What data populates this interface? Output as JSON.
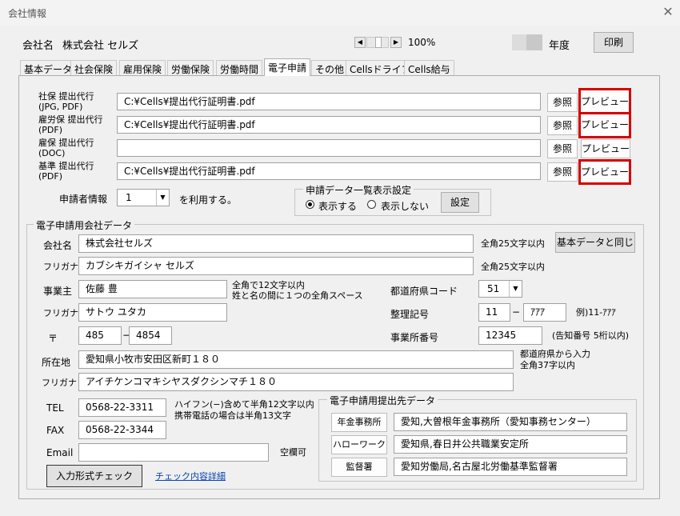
{
  "window": {
    "title": "会社情報",
    "close_glyph": "✕"
  },
  "header": {
    "company_label": "会社名",
    "company_name": "株式会社 セルズ",
    "zoom": "100%",
    "year_label": "年度",
    "print_label": "印刷"
  },
  "tabs": [
    "基本データ",
    "社会保険",
    "雇用保険",
    "労働保険",
    "労働時間",
    "電子申請",
    "その他",
    "Cellsドライブ",
    "Cells給与"
  ],
  "active_tab": "電子申請",
  "agency": {
    "rows": [
      {
        "label1": "社保 提出代行",
        "label2": "(JPG, PDF)",
        "path": "C:¥Cells¥提出代行証明書.pdf",
        "browse": "参照",
        "preview": "プレビュー",
        "highlight": true
      },
      {
        "label1": "雇労保 提出代行",
        "label2": "(PDF)",
        "path": "C:¥Cells¥提出代行証明書.pdf",
        "browse": "参照",
        "preview": "プレビュー",
        "highlight": true
      },
      {
        "label1": "雇保 提出代行",
        "label2": "(DOC)",
        "path": "",
        "browse": "参照",
        "preview": "プレビュー",
        "highlight": false
      },
      {
        "label1": "基準 提出代行",
        "label2": "(PDF)",
        "path": "C:¥Cells¥提出代行証明書.pdf",
        "browse": "参照",
        "preview": "プレビュー",
        "highlight": true
      }
    ]
  },
  "applicant": {
    "label": "申請者情報",
    "value": "1",
    "suffix": "を利用する。"
  },
  "list_display": {
    "title": "申請データ一覧表示設定",
    "option_show": "表示する",
    "option_hide": "表示しない",
    "selected": "表示する",
    "settings_label": "設定"
  },
  "company_data": {
    "group_title": "電子申請用会社データ",
    "company_name_label": "会社名",
    "company_name": "株式会社セルズ",
    "company_name_note": "全角25文字以内",
    "same_as_basic": "基本データと同じ",
    "furigana_label": "フリガナ",
    "furigana": "カブシキガイシャ セルズ",
    "furigana_note": "全角25文字以内",
    "owner_label": "事業主",
    "owner": "佐藤 豊",
    "owner_note1": "全角で12文字以内",
    "owner_note2": "姓と名の間に１つの全角スペース",
    "owner_kana_label": "フリガナ",
    "owner_kana": "サトウ ユタカ",
    "postal_label": "〒",
    "postal1": "485",
    "postal_dash": "−",
    "postal2": "4854",
    "pref_code_label": "都道府県コード",
    "pref_code": "51",
    "ref_no_label": "整理記号",
    "ref_no1": "11",
    "ref_no_dash": "−",
    "ref_no2": "ｱｱｱ",
    "ref_no_example": "例)11-ｱｱｱ",
    "office_no_label": "事業所番号",
    "office_no": "12345",
    "office_no_note": "(告知番号 5桁以内)",
    "address_label": "所在地",
    "address": "愛知県小牧市安田区新町１８０",
    "address_note1": "都道府県から入力",
    "address_note2": "全角37字以内",
    "address_kana_label": "フリガナ",
    "address_kana": "アイチケンコマキシヤスダクシンマチ１８０",
    "tel_label": "TEL",
    "tel": "0568-22-3311",
    "tel_note1": "ハイフン(−)含めて半角12文字以内",
    "tel_note2": "携帯電話の場合は半角13文字",
    "fax_label": "FAX",
    "fax": "0568-22-3344",
    "email_label": "Email",
    "email": "",
    "email_note": "空欄可",
    "check_button": "入力形式チェック",
    "check_details_link": "チェック内容詳細"
  },
  "submission": {
    "group_title": "電子申請用提出先データ",
    "rows": [
      {
        "button": "年金事務所",
        "value": "愛知,大曽根年金事務所（愛知事務センター）"
      },
      {
        "button": "ハローワーク",
        "value": "愛知県,春日井公共職業安定所"
      },
      {
        "button": "監督署",
        "value": "愛知労働局,名古屋北労働基準監督署"
      }
    ]
  }
}
